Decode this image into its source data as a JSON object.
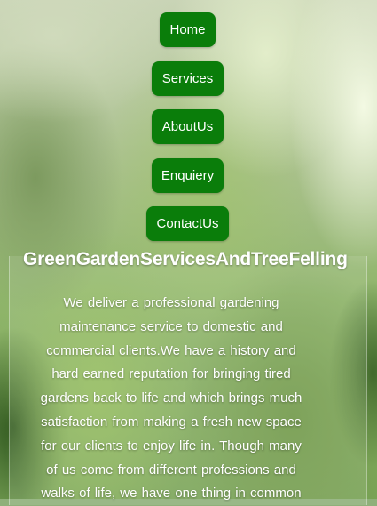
{
  "nav": {
    "items": [
      {
        "label": "Home"
      },
      {
        "label": "Services"
      },
      {
        "label": "AboutUs"
      },
      {
        "label": "Enquiery"
      },
      {
        "label": "ContactUs"
      }
    ]
  },
  "main": {
    "title": "GreenGardenServicesAndTreeFelling",
    "intro_lines": [
      "We deliver a professional gardening",
      "maintenance service to domestic and",
      "commercial clients.We have a history and",
      "hard earned reputation for bringing tired",
      "gardens back to life and which brings much",
      "satisfaction from making a fresh new space",
      "for our clients to enjoy life in. Though many",
      "of us come from different professions and",
      "walks of life, we have one thing in common"
    ]
  },
  "colors": {
    "button_bg": "#0a7d0a",
    "text": "#ffffff"
  }
}
